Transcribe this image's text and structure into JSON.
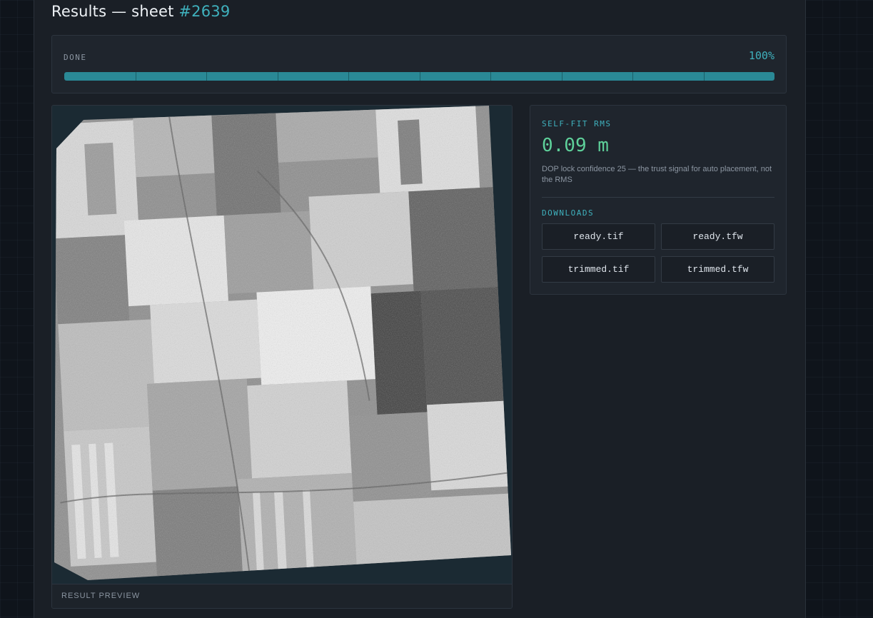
{
  "header": {
    "title_prefix": "Results — sheet ",
    "sheet_number": "#2639"
  },
  "progress": {
    "status": "DONE",
    "percent_label": "100%",
    "fraction": 1.0,
    "segments": 10,
    "accent_color": "#2a8996"
  },
  "preview": {
    "caption": "RESULT PREVIEW",
    "image_kind": "grayscale aerial orthophoto"
  },
  "fit": {
    "label": "SELF-FIT RMS",
    "value": "0.09 m",
    "note": "DOP lock confidence 25 — the trust signal for auto placement, not the RMS",
    "value_color": "#5ed09a"
  },
  "downloads": {
    "label": "DOWNLOADS",
    "files": [
      "ready.tif",
      "ready.tfw",
      "trimmed.tif",
      "trimmed.tfw"
    ]
  }
}
